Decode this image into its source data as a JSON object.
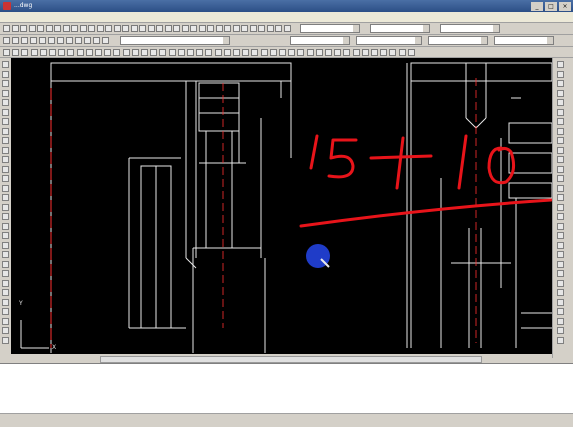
{
  "window": {
    "title": "...dwg"
  },
  "menu": [],
  "toolbars": {
    "layer_combo": "",
    "style_combo_1": "",
    "style_combo_2": "",
    "style_combo_3": "",
    "color_combo": "",
    "linetype_combo": "",
    "lineweight_combo": "",
    "plotstyle_combo": ""
  },
  "canvas": {
    "annotation_text": "15+10",
    "annotation_color": "#e8141a",
    "ucs_y_label": "Y",
    "ucs_x_label": "X"
  },
  "tabs": [],
  "command_lines": [],
  "status_items": []
}
